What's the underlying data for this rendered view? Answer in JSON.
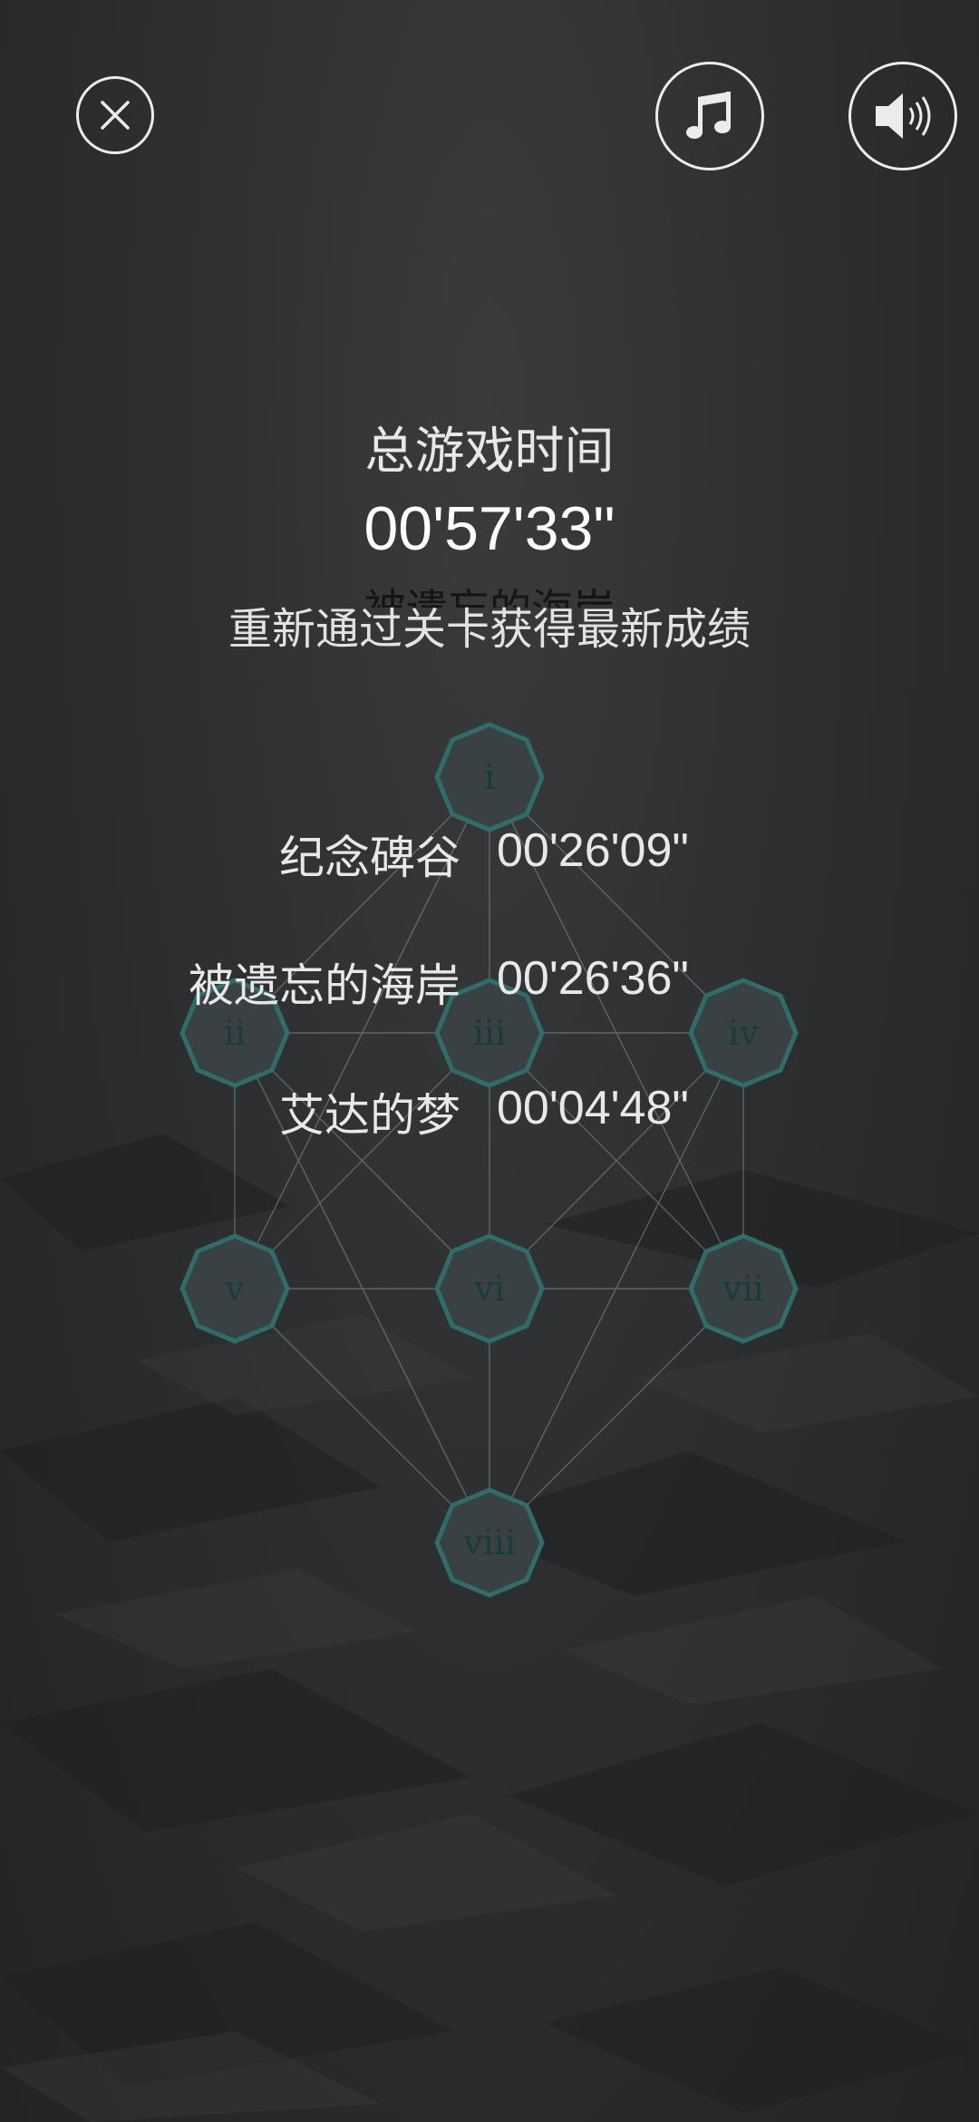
{
  "controls": {
    "close_icon": "close-icon",
    "music_icon": "music-note-icon",
    "sound_icon": "speaker-icon"
  },
  "summary": {
    "total_label": "总游戏时间",
    "total_time": "00'57'33\"",
    "hidden_title": "被遗忘的海岸",
    "hint": "重新通过关卡获得最新成绩"
  },
  "levels": [
    {
      "name": "纪念碑谷",
      "time": "00'26'09\""
    },
    {
      "name": "被遗忘的海岸",
      "time": "00'26'36\""
    },
    {
      "name": "艾达的梦",
      "time": "00'04'48\""
    }
  ],
  "chapters": [
    "i",
    "ii",
    "iii",
    "iv",
    "v",
    "vi",
    "vii",
    "viii"
  ],
  "colors": {
    "node_fill": "#3a4142",
    "node_stroke": "#2f6c6a",
    "node_label": "#183c3c",
    "edge": "#8a8e8e"
  }
}
